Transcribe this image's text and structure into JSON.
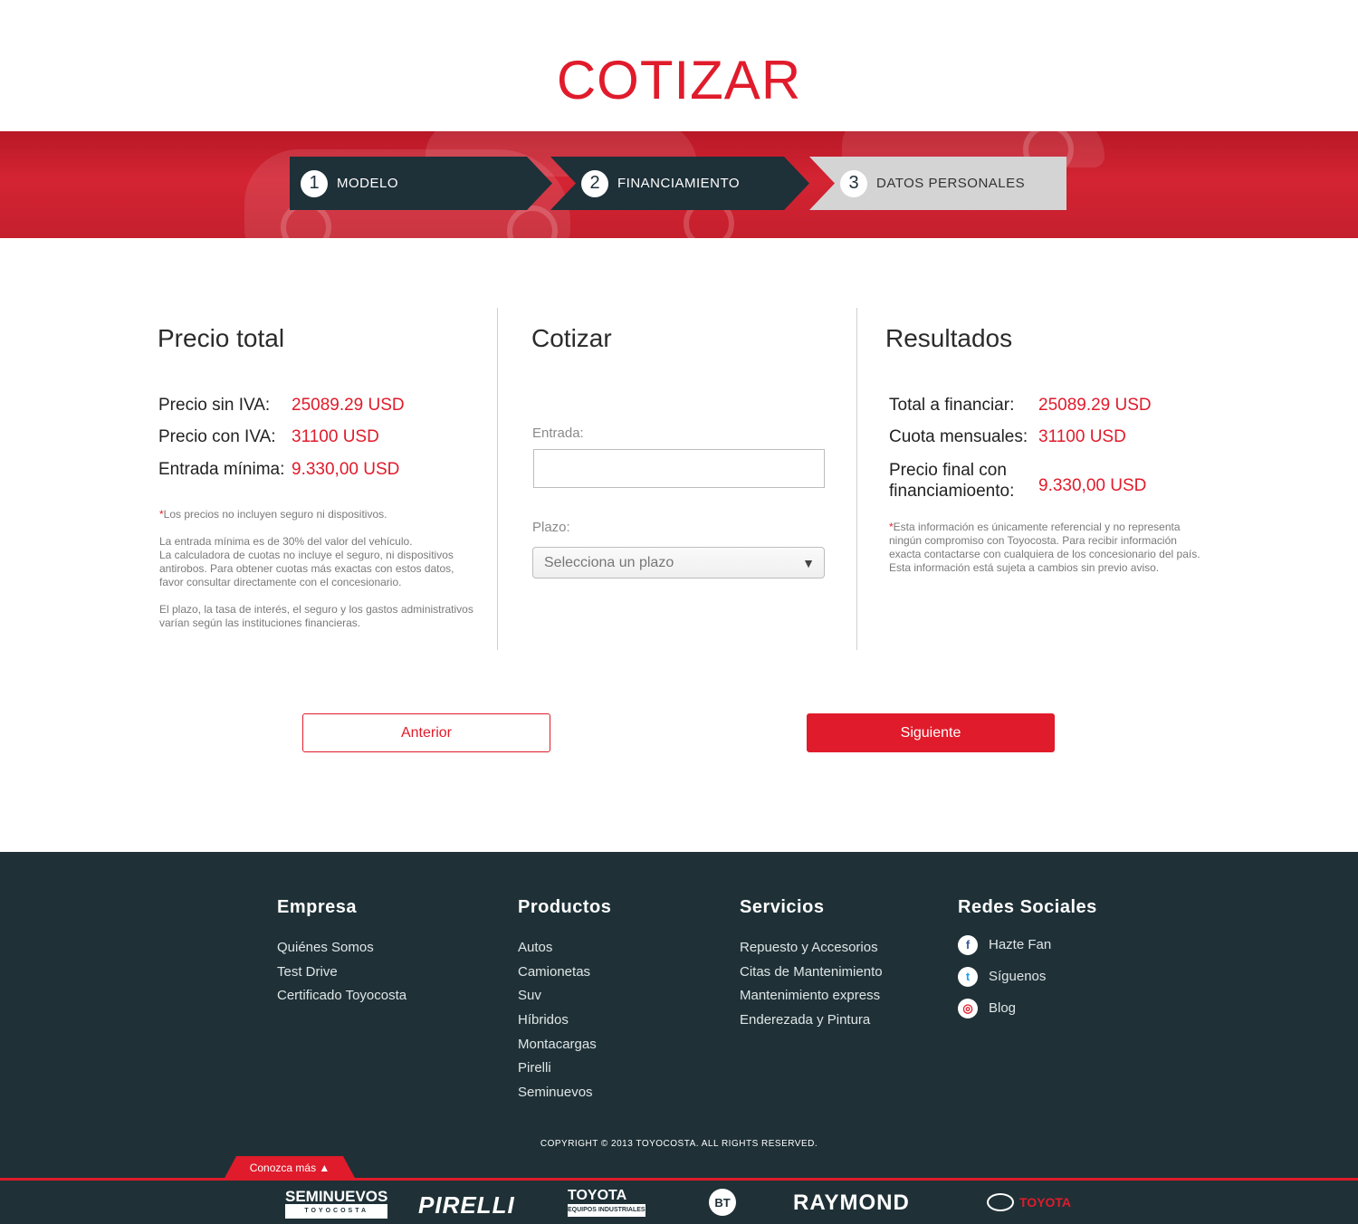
{
  "header": {
    "title": "COTIZAR"
  },
  "steps": [
    {
      "number": "1",
      "label": "MODELO"
    },
    {
      "number": "2",
      "label": "FINANCIAMIENTO"
    },
    {
      "number": "3",
      "label": "DATOS PERSONALES"
    }
  ],
  "precio": {
    "heading": "Precio total",
    "rows": [
      {
        "label": "Precio sin IVA:",
        "value": "25089.29 USD"
      },
      {
        "label": "Precio con IVA:",
        "value": "31100 USD"
      },
      {
        "label": "Entrada mínima:",
        "value": "9.330,00 USD"
      }
    ],
    "note_asterisk": "*",
    "note_1": "Los precios no incluyen seguro ni dispositivos.",
    "note_2": "La entrada mínima es de 30% del valor del vehículo.",
    "note_3": "La calculadora de cuotas no incluye el seguro, ni dispositivos antirobos. Para obtener cuotas más exactas con estos datos, favor consultar directamente con el concesionario.",
    "note_4": "El plazo, la tasa de interés, el seguro y los gastos administrativos varían según las instituciones financieras."
  },
  "cotizar": {
    "heading": "Cotizar",
    "entrada_label": "Entrada:",
    "entrada_value": "",
    "plazo_label": "Plazo:",
    "plazo_selected": "Selecciona un plazo"
  },
  "resultados": {
    "heading": "Resultados",
    "rows": [
      {
        "label": "Total a financiar:",
        "value": "25089.29 USD"
      },
      {
        "label": "Cuota mensuales:",
        "value": "31100 USD"
      },
      {
        "label_1": "Precio final con",
        "label_2": "financiamioento:",
        "value": "9.330,00 USD"
      }
    ],
    "note_asterisk": "*",
    "note": "Esta información es únicamente referencial y no representa ningún compromiso con Toyocosta. Para recibir información exacta contactarse con cualquiera de los concesionario del país. Esta información está sujeta a cambios sin previo aviso."
  },
  "buttons": {
    "prev": "Anterior",
    "next": "Siguiente"
  },
  "footer": {
    "empresa": {
      "title": "Empresa",
      "links": [
        "Quiénes Somos",
        "Test Drive",
        "Certificado Toyocosta"
      ]
    },
    "productos": {
      "title": "Productos",
      "links": [
        "Autos",
        "Camionetas",
        "Suv",
        "Híbridos",
        "Montacargas",
        "Pirelli",
        "Seminuevos"
      ]
    },
    "servicios": {
      "title": "Servicios",
      "links": [
        "Repuesto y Accesorios",
        "Citas de Mantenimiento",
        "Mantenimiento express",
        "Enderezada y Pintura"
      ]
    },
    "redes": {
      "title": "Redes Sociales",
      "items": [
        {
          "label": "Hazte Fan",
          "icon": "facebook-icon"
        },
        {
          "label": "Síguenos",
          "icon": "twitter-icon"
        },
        {
          "label": "Blog",
          "icon": "toyota-icon"
        }
      ]
    },
    "copyright": "COPYRIGHT © 2013 TOYOCOSTA. ALL RIGHTS RESERVED.",
    "more_tab": "Conozca más ▲"
  },
  "brands": {
    "seminuevos": "SEMINUEVOS",
    "seminuevos_sub": "TOYOCOSTA",
    "pirelli": "PIRELLI",
    "toyota_eq": "TOYOTA",
    "toyota_eq_sub": "EQUIPOS INDUSTRIALES",
    "bt": "BT",
    "raymond": "RAYMOND",
    "toyota": "TOYOTA"
  },
  "colors": {
    "accent": "#e01b2b",
    "dark": "#1e3038",
    "inactive_step": "#d4d4d4"
  }
}
